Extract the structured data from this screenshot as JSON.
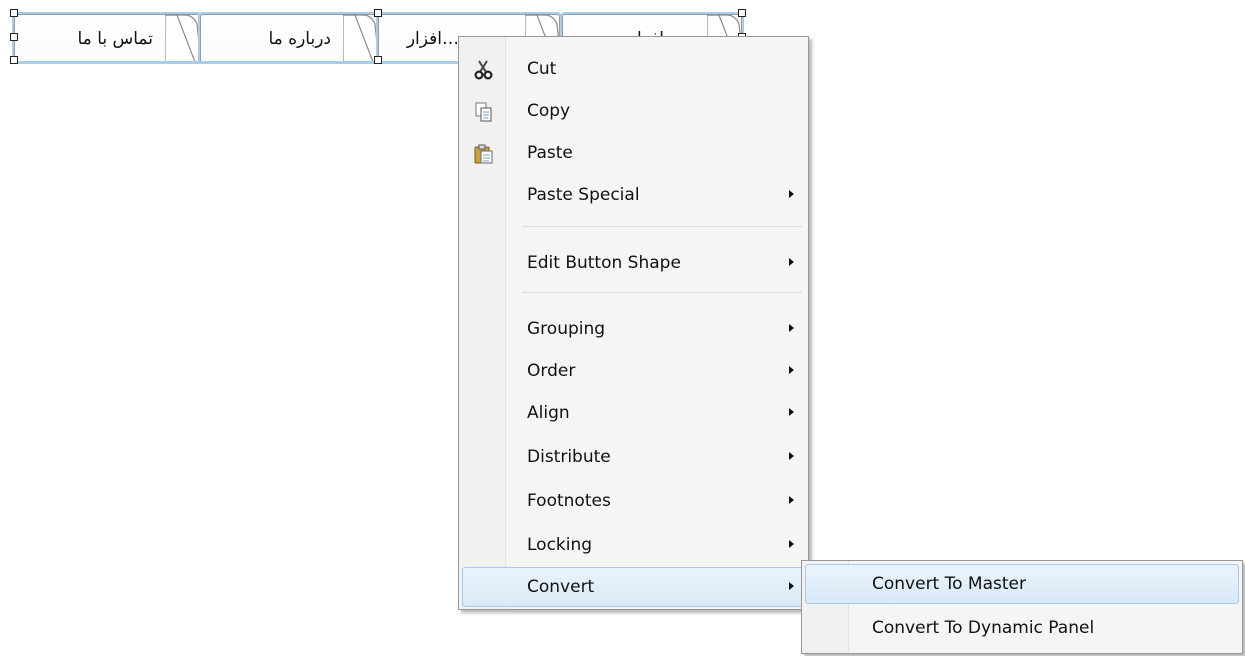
{
  "tabs": [
    {
      "label": "تماس با ما"
    },
    {
      "label": "درباره ما"
    },
    {
      "label": "…افزار"
    },
    {
      "label": "…افزار"
    }
  ],
  "context_menu": {
    "items": [
      {
        "label": "Cut",
        "icon": "scissors-icon",
        "has_submenu": false
      },
      {
        "label": "Copy",
        "icon": "copy-icon",
        "has_submenu": false
      },
      {
        "label": "Paste",
        "icon": "paste-icon",
        "has_submenu": false
      },
      {
        "label": "Paste Special",
        "has_submenu": true
      },
      {
        "label": "Edit Button Shape",
        "has_submenu": true
      },
      {
        "label": "Grouping",
        "has_submenu": true
      },
      {
        "label": "Order",
        "has_submenu": true
      },
      {
        "label": "Align",
        "has_submenu": true
      },
      {
        "label": "Distribute",
        "has_submenu": true
      },
      {
        "label": "Footnotes",
        "has_submenu": true
      },
      {
        "label": "Locking",
        "has_submenu": true
      },
      {
        "label": "Convert",
        "has_submenu": true,
        "highlighted": true
      }
    ]
  },
  "convert_submenu": {
    "items": [
      {
        "label": "Convert To Master",
        "highlighted": true
      },
      {
        "label": "Convert To Dynamic Panel"
      }
    ]
  },
  "colors": {
    "selection": "#a8cdea",
    "menu_background": "#f5f5f5",
    "highlight": "#d9e9f7"
  }
}
